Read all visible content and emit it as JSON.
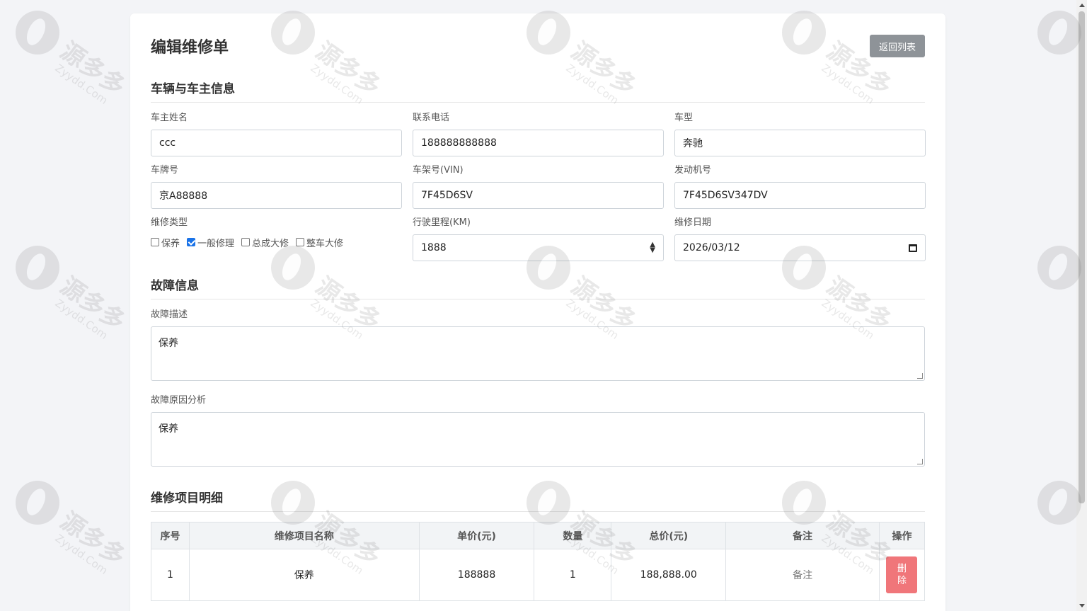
{
  "page": {
    "title": "编辑维修单",
    "back_label": "返回列表"
  },
  "vehicle_section": {
    "title": "车辆与车主信息",
    "owner_name": {
      "label": "车主姓名",
      "value": "ccc"
    },
    "phone": {
      "label": "联系电话",
      "value": "188888888888"
    },
    "car_model": {
      "label": "车型",
      "value": "奔驰"
    },
    "plate": {
      "label": "车牌号",
      "value": "京A88888"
    },
    "vin": {
      "label": "车架号(VIN)",
      "value": "7F45D6SV"
    },
    "engine": {
      "label": "发动机号",
      "value": "7F45D6SV347DV"
    },
    "repair_type": {
      "label": "维修类型",
      "options": [
        {
          "label": "保养",
          "checked": false
        },
        {
          "label": "一般修理",
          "checked": true
        },
        {
          "label": "总成大修",
          "checked": false
        },
        {
          "label": "整车大修",
          "checked": false
        }
      ]
    },
    "mileage": {
      "label": "行驶里程(KM)",
      "value": "1888"
    },
    "repair_date": {
      "label": "维修日期",
      "value": "2026/03/12"
    }
  },
  "fault_section": {
    "title": "故障信息",
    "description": {
      "label": "故障描述",
      "value": "保养"
    },
    "cause": {
      "label": "故障原因分析",
      "value": "保养"
    }
  },
  "items_section": {
    "title": "维修项目明细",
    "columns": [
      "序号",
      "维修项目名称",
      "单价(元)",
      "数量",
      "总价(元)",
      "备注",
      "操作"
    ],
    "rows": [
      {
        "index": "1",
        "name": "保养",
        "unit_price": "188888",
        "qty": "1",
        "total": "188,888.00",
        "note": "备注",
        "action": "删除"
      }
    ]
  },
  "watermark": {
    "text": "源多多",
    "sub": "Zyydd.Com"
  },
  "colors": {
    "accent": "#1a73e8",
    "danger": "#f0767a",
    "secondary": "#8e9398"
  }
}
